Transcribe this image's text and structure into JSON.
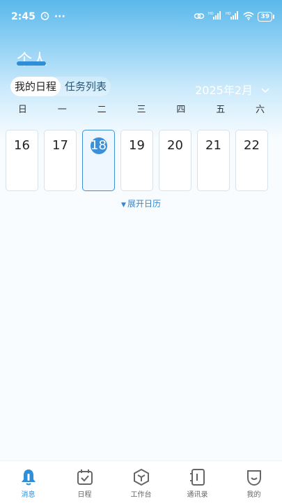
{
  "status_bar": {
    "time": "2:45",
    "more": "···",
    "hd1": "HD",
    "hd2": "HD",
    "battery": "39"
  },
  "header": {
    "title": "个人"
  },
  "tabs": [
    {
      "label": "我的日程",
      "active": true
    },
    {
      "label": "任务列表",
      "active": false
    }
  ],
  "calendar": {
    "month_label": "2025年2月",
    "weekdays": [
      "日",
      "一",
      "二",
      "三",
      "四",
      "五",
      "六"
    ],
    "days": [
      "16",
      "17",
      "18",
      "19",
      "20",
      "21",
      "22"
    ],
    "selected_day": "18",
    "expand_label": "展开日历"
  },
  "bottom_nav": [
    {
      "label": "消息",
      "icon": "bell-icon",
      "active": true
    },
    {
      "label": "日程",
      "icon": "calendar-check-icon",
      "active": false
    },
    {
      "label": "工作台",
      "icon": "hexagon-icon",
      "active": false
    },
    {
      "label": "通讯录",
      "icon": "contacts-book-icon",
      "active": false
    },
    {
      "label": "我的",
      "icon": "profile-icon",
      "active": false
    }
  ],
  "colors": {
    "accent": "#2f8ed6",
    "header_gradient_top": "#5ab8ea"
  }
}
